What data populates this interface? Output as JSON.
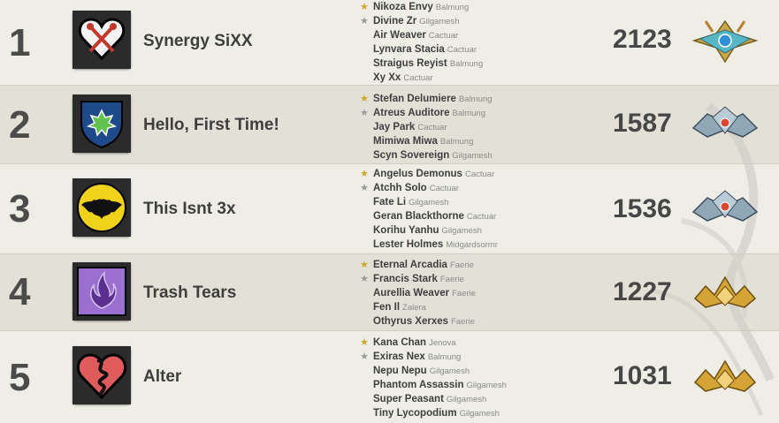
{
  "rows": [
    {
      "rank": "1",
      "team": "Synergy SiXX",
      "score": "2123",
      "crest_icon": "keyblade-heart-icon",
      "badge_icon": "crystal-winged-badge-icon",
      "members": [
        {
          "name": "Nikoza Envy",
          "world": "Balmung",
          "role": "leader-star-icon"
        },
        {
          "name": "Divine Zr",
          "world": "Gilgamesh",
          "role": "subleader-star-icon"
        },
        {
          "name": "Air Weaver",
          "world": "Cactuar",
          "role": ""
        },
        {
          "name": "Lynvara Stacia",
          "world": "Cactuar",
          "role": ""
        },
        {
          "name": "Straigus Reyist",
          "world": "Balmung",
          "role": ""
        },
        {
          "name": "Xy Xx",
          "world": "Cactuar",
          "role": ""
        }
      ]
    },
    {
      "rank": "2",
      "team": "Hello, First Time!",
      "score": "1587",
      "crest_icon": "leaf-shield-icon",
      "badge_icon": "diamond-badge-icon",
      "members": [
        {
          "name": "Stefan Delumiere",
          "world": "Balmung",
          "role": "leader-star-icon"
        },
        {
          "name": "Atreus Auditore",
          "world": "Balmung",
          "role": "subleader-star-icon"
        },
        {
          "name": "Jay Park",
          "world": "Cactuar",
          "role": ""
        },
        {
          "name": "Mimiwa Miwa",
          "world": "Balmung",
          "role": ""
        },
        {
          "name": "Scyn Sovereign",
          "world": "Gilgamesh",
          "role": ""
        }
      ]
    },
    {
      "rank": "3",
      "team": "This Isnt 3x",
      "score": "1536",
      "crest_icon": "bat-emblem-icon",
      "badge_icon": "diamond-badge-icon",
      "members": [
        {
          "name": "Angelus Demonus",
          "world": "Cactuar",
          "role": "leader-star-icon"
        },
        {
          "name": "Atchh Solo",
          "world": "Cactuar",
          "role": "subleader-star-icon"
        },
        {
          "name": "Fate Li",
          "world": "Gilgamesh",
          "role": ""
        },
        {
          "name": "Geran Blackthorne",
          "world": "Cactuar",
          "role": ""
        },
        {
          "name": "Korihu Yanhu",
          "world": "Gilgamesh",
          "role": ""
        },
        {
          "name": "Lester Holmes",
          "world": "Midgardsormr",
          "role": ""
        }
      ]
    },
    {
      "rank": "4",
      "team": "Trash Tears",
      "score": "1227",
      "crest_icon": "purple-flame-icon",
      "badge_icon": "gold-crown-badge-icon",
      "members": [
        {
          "name": "Eternal Arcadia",
          "world": "Faerie",
          "role": "leader-star-icon"
        },
        {
          "name": "Francis Stark",
          "world": "Faerie",
          "role": "subleader-star-icon"
        },
        {
          "name": "Aurellia Weaver",
          "world": "Faerie",
          "role": ""
        },
        {
          "name": "Fen Il",
          "world": "Zalera",
          "role": ""
        },
        {
          "name": "Othyrus Xerxes",
          "world": "Faerie",
          "role": ""
        }
      ]
    },
    {
      "rank": "5",
      "team": "Alter",
      "score": "1031",
      "crest_icon": "serpent-heart-icon",
      "badge_icon": "gold-crown-badge-icon",
      "members": [
        {
          "name": "Kana Chan",
          "world": "Jenova",
          "role": "leader-star-icon"
        },
        {
          "name": "Exiras Nex",
          "world": "Balmung",
          "role": "subleader-star-icon"
        },
        {
          "name": "Nepu Nepu",
          "world": "Gilgamesh",
          "role": ""
        },
        {
          "name": "Phantom Assassin",
          "world": "Gilgamesh",
          "role": ""
        },
        {
          "name": "Super Peasant",
          "world": "Gilgamesh",
          "role": ""
        },
        {
          "name": "Tiny Lycopodium",
          "world": "Gilgamesh",
          "role": ""
        }
      ]
    }
  ],
  "colors": {
    "leader_star": "#d1a62a",
    "subleader_star": "#9a9a9a",
    "row_shade": "#dcdad0",
    "background": "#eeede6"
  }
}
